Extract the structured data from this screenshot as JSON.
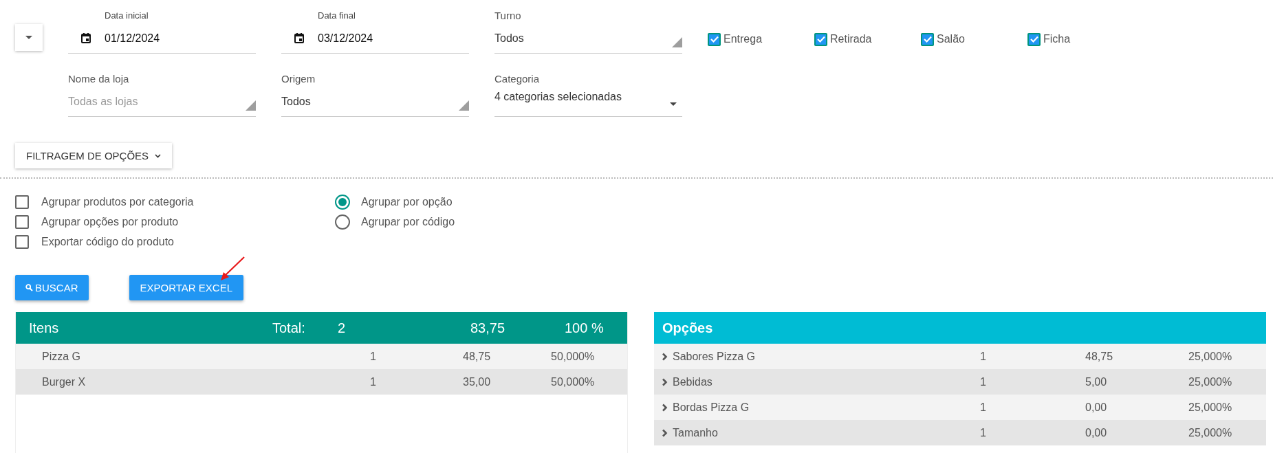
{
  "fields": [
    {
      "kind": "date",
      "label": "Data inicial",
      "value": "01/12/2024"
    },
    {
      "kind": "date",
      "label": "Data final",
      "value": "03/12/2024"
    },
    {
      "kind": "select",
      "label": "Turno",
      "value": "Todos"
    },
    {
      "kind": "select",
      "label": "Nome da loja",
      "placeholder": "Todas as lojas"
    },
    {
      "kind": "select",
      "label": "Origem",
      "value": "Todos"
    },
    {
      "kind": "dropdown",
      "label": "Categoria",
      "value": "4 categorias selecionadas"
    }
  ],
  "channels": [
    {
      "label": "Entrega",
      "checked": true
    },
    {
      "label": "Retirada",
      "checked": true
    },
    {
      "label": "Salão",
      "checked": true
    },
    {
      "label": "Ficha",
      "checked": true
    }
  ],
  "filter_button": "FILTRAGEM DE OPÇÕES",
  "options": [
    {
      "label": "Agrupar produtos por categoria",
      "checked": false
    },
    {
      "label": "Agrupar opções por produto",
      "checked": false
    },
    {
      "label": "Exportar código do produto",
      "checked": false
    }
  ],
  "grouping": [
    {
      "label": "Agrupar por opção",
      "selected": true
    },
    {
      "label": "Agrupar por código",
      "selected": false
    }
  ],
  "buttons": {
    "search": "BUSCAR",
    "export": "EXPORTAR EXCEL"
  },
  "items_table": {
    "title": "Itens",
    "total_label": "Total:",
    "total_qty": "2",
    "total_value": "83,75",
    "total_pct": "100 %",
    "rows": [
      {
        "name": "Pizza G",
        "qty": "1",
        "value": "48,75",
        "pct": "50,000%"
      },
      {
        "name": "Burger X",
        "qty": "1",
        "value": "35,00",
        "pct": "50,000%"
      }
    ]
  },
  "options_table": {
    "title": "Opções",
    "rows": [
      {
        "name": "Sabores Pizza G",
        "qty": "1",
        "value": "48,75",
        "pct": "25,000%"
      },
      {
        "name": "Bebidas",
        "qty": "1",
        "value": "5,00",
        "pct": "25,000%"
      },
      {
        "name": "Bordas Pizza G",
        "qty": "1",
        "value": "0,00",
        "pct": "25,000%"
      },
      {
        "name": "Tamanho",
        "qty": "1",
        "value": "0,00",
        "pct": "25,000%"
      }
    ]
  }
}
